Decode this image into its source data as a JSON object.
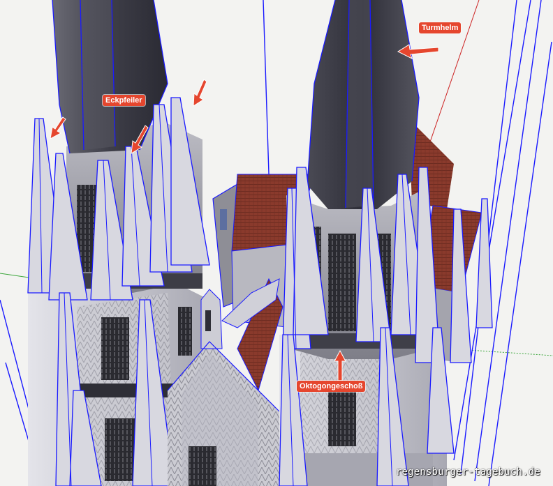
{
  "annotations": {
    "turmhelm": "Turmhelm",
    "eckpfeiler": "Eckpfeiler",
    "oktogongeschoss": "Oktogongeschoß"
  },
  "watermark": "regensburger-tagebuch.de",
  "colors": {
    "background": "#f3f3f1",
    "edge_highlight": "#1a1aff",
    "annotation": "#e5462e",
    "roof": "#8a3a2c",
    "stone_light": "#cfcfd4",
    "stone_dark": "#4a4a52",
    "axis_red": "#cc2222",
    "axis_green": "#3aa53a"
  },
  "icons": [
    "arrow-icon"
  ]
}
